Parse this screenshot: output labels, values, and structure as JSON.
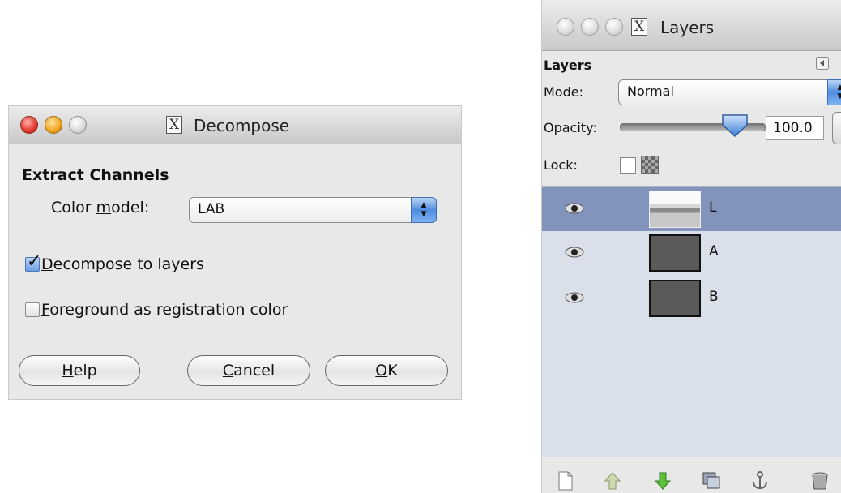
{
  "decompose_dialog": {
    "title": "Decompose",
    "section_heading": "Extract Channels",
    "color_model_label_prefix": "Color ",
    "color_model_label_mnemonic": "m",
    "color_model_label_suffix": "odel:",
    "color_model_value": "LAB",
    "decompose_to_layers": {
      "mnemonic": "D",
      "rest": "ecompose to layers",
      "checked": true
    },
    "foreground_registration": {
      "mnemonic": "F",
      "rest": "oreground as registration color",
      "checked": false
    },
    "buttons": {
      "help_mnemonic": "H",
      "help_rest": "elp",
      "cancel_mnemonic": "C",
      "cancel_rest": "ancel",
      "ok_mnemonic": "O",
      "ok_rest": "K"
    }
  },
  "layers_dock": {
    "window_title": "Layers",
    "panel_heading": "Layers",
    "mode_label": "Mode:",
    "mode_value": "Normal",
    "opacity_label": "Opacity:",
    "opacity_value": "100.0",
    "opacity_fraction": 0.82,
    "lock_label": "Lock:",
    "layers": [
      {
        "name": "L",
        "visible": true,
        "selected": true
      },
      {
        "name": "A",
        "visible": true,
        "selected": false
      },
      {
        "name": "B",
        "visible": true,
        "selected": false
      }
    ],
    "toolbar_icons": [
      "new-layer-icon",
      "raise-layer-icon",
      "lower-layer-icon",
      "duplicate-layer-icon",
      "anchor-layer-icon",
      "delete-layer-icon"
    ]
  },
  "colors": {
    "selection": "#8294bc",
    "list_background": "#d9e0ea",
    "accent_blue": "#4f8de0"
  }
}
